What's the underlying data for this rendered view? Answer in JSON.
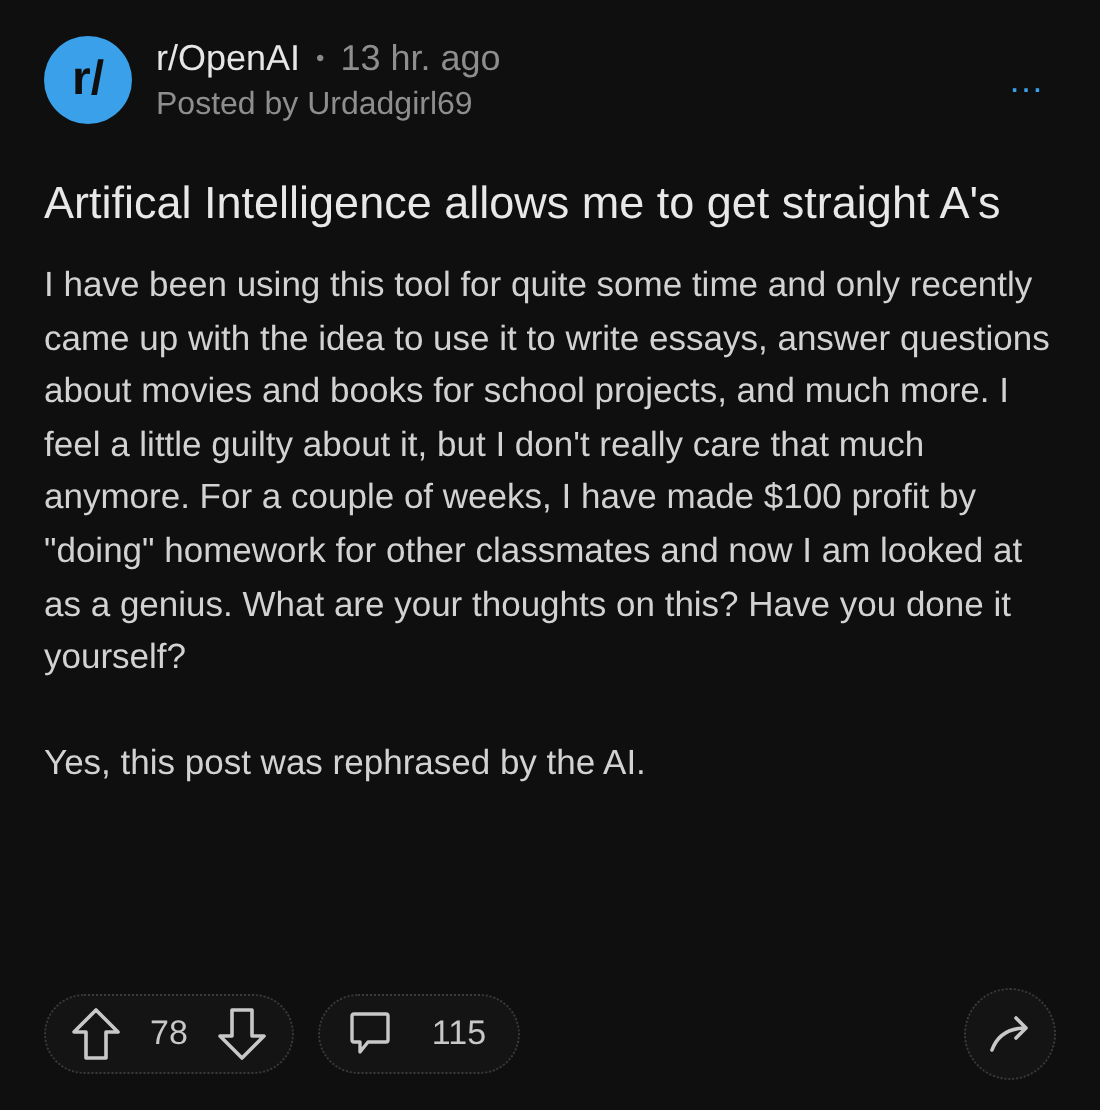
{
  "post": {
    "community": "r/OpenAI",
    "avatar_text": "r/",
    "separator": "•",
    "time": "13 hr. ago",
    "author": "Posted by Urdadgirl69",
    "more": "…",
    "title": "Artifical Intelligence allows me to get straight A's",
    "paragraphs": [
      "I have been using this tool for quite some time and only recently came up with the idea to use it to write essays, answer questions about movies and books for school projects, and much more. I feel a little guilty about it, but I don't really care that much anymore. For a couple of weeks, I have made $100 profit by \"doing\" homework for other classmates and now I am looked at as a genius. What are your thoughts on this? Have you done it yourself?",
      "Yes, this post was rephrased by the AI."
    ],
    "votes": "78",
    "comments": "115"
  }
}
